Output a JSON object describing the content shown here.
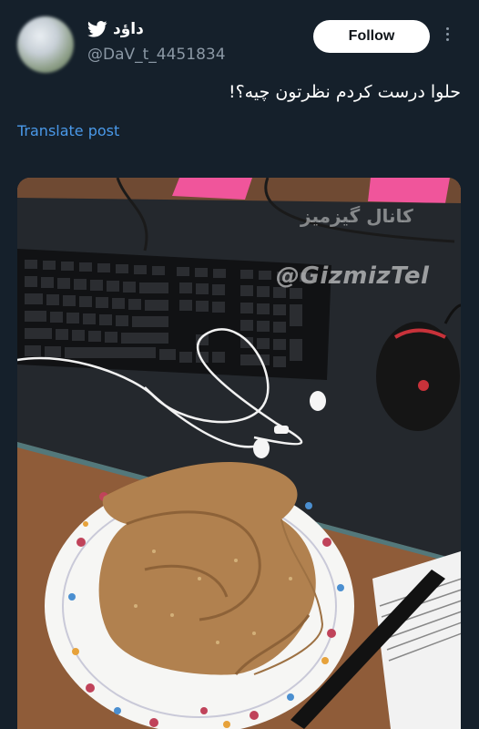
{
  "user": {
    "display_name": "داﺅد",
    "handle": "@DaV_t_4451834",
    "verified_icon": "twitter-bird-icon"
  },
  "actions": {
    "follow_label": "Follow",
    "more_icon": "more-vertical-icon"
  },
  "post": {
    "text": "حلوا درست کردم نظرتون چیه؟!",
    "translate_label": "Translate post"
  },
  "media": {
    "watermark_fa": "کانال گیزمیز",
    "watermark_en": "@GizmizTel"
  },
  "colors": {
    "background": "#15202b",
    "link": "#4a99e9",
    "follow_bg": "#ffffff"
  }
}
